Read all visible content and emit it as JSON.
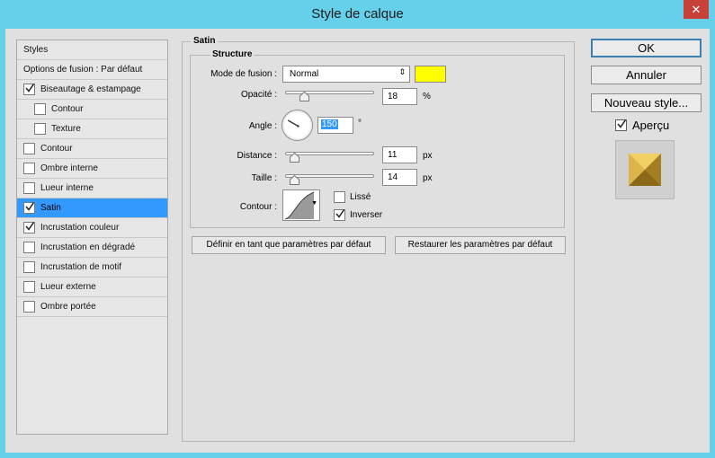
{
  "window": {
    "title": "Style de calque",
    "close_glyph": "✕"
  },
  "styles_list": {
    "header": "Styles",
    "blending_options": "Options de fusion : Par défaut",
    "items": [
      {
        "label": "Biseautage & estampage",
        "checked": true,
        "selected": false,
        "indent": false
      },
      {
        "label": "Contour",
        "checked": false,
        "selected": false,
        "indent": true
      },
      {
        "label": "Texture",
        "checked": false,
        "selected": false,
        "indent": true
      },
      {
        "label": "Contour",
        "checked": false,
        "selected": false,
        "indent": false
      },
      {
        "label": "Ombre interne",
        "checked": false,
        "selected": false,
        "indent": false
      },
      {
        "label": "Lueur interne",
        "checked": false,
        "selected": false,
        "indent": false
      },
      {
        "label": "Satin",
        "checked": true,
        "selected": true,
        "indent": false
      },
      {
        "label": "Incrustation couleur",
        "checked": true,
        "selected": false,
        "indent": false
      },
      {
        "label": "Incrustation en dégradé",
        "checked": false,
        "selected": false,
        "indent": false
      },
      {
        "label": "Incrustation de motif",
        "checked": false,
        "selected": false,
        "indent": false
      },
      {
        "label": "Lueur externe",
        "checked": false,
        "selected": false,
        "indent": false
      },
      {
        "label": "Ombre portée",
        "checked": false,
        "selected": false,
        "indent": false
      }
    ]
  },
  "satin": {
    "title": "Satin",
    "structure_title": "Structure",
    "blend_mode_label": "Mode de fusion :",
    "blend_mode_value": "Normal",
    "color": "#ffff00",
    "opacity_label": "Opacité :",
    "opacity_value": "18",
    "opacity_unit": "%",
    "opacity_fraction": 0.18,
    "angle_label": "Angle :",
    "angle_value": "150",
    "angle_unit": "°",
    "distance_label": "Distance :",
    "distance_value": "11",
    "distance_unit": "px",
    "size_label": "Taille :",
    "size_value": "14",
    "size_unit": "px",
    "contour_label": "Contour :",
    "antialias_label": "Lissé",
    "antialias_checked": false,
    "invert_label": "Inverser",
    "invert_checked": true,
    "set_default_button": "Définir en tant que paramètres par défaut",
    "reset_default_button": "Restaurer les paramètres par défaut"
  },
  "buttons": {
    "ok": "OK",
    "cancel": "Annuler",
    "new_style": "Nouveau style...",
    "preview_label": "Aperçu",
    "preview_checked": true
  }
}
